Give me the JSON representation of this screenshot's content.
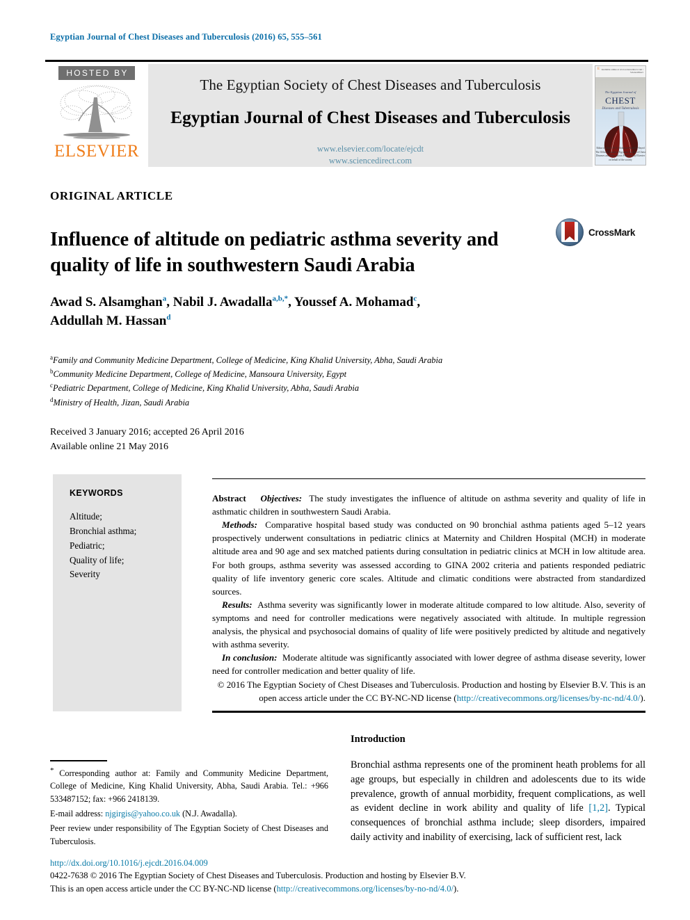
{
  "running_head": "Egyptian Journal of Chest Diseases and Tuberculosis (2016) 65, 555–561",
  "masthead": {
    "hosted_by": "HOSTED BY",
    "publisher": "ELSEVIER",
    "society_line": "The Egyptian Society of Chest Diseases and Tuberculosis",
    "journal_line": "Egyptian Journal of Chest Diseases and Tuberculosis",
    "url_1": "www.elsevier.com/locate/ejcdt",
    "url_2": "www.sciencedirect.com",
    "cover": {
      "title_main": "CHEST",
      "title_pre": "The Egyptian Journal of",
      "title_sub": "Diseases and Tuberculosis",
      "publisher_mark": "ELSEVIER",
      "top_right": "Available online at www.sciencedirect.com / ScienceDirect",
      "footer": "Editor in Chief: M.Y. Mohamed Awad El-Sayed\nThe Official Journal of Egyptian Society of Chest Diseases and Tuberculosis\nPublished by Elsevier on behalf of the society"
    }
  },
  "article": {
    "kind": "ORIGINAL ARTICLE",
    "title": "Influence of altitude on pediatric asthma severity and quality of life in southwestern Saudi Arabia",
    "crossmark_label": "CrossMark",
    "authors_line_1": "Awad S. Alsamghan",
    "authors_marks_1": "a",
    "authors_line_2": ", Nabil J. Awadalla",
    "authors_marks_2": "a,b,*",
    "authors_line_3": ", Youssef A. Mohamad",
    "authors_marks_3": "c",
    "authors_line_4": ",",
    "authors_line_5": "Addullah M. Hassan",
    "authors_marks_5": "d",
    "affiliations": [
      {
        "mark": "a",
        "text": "Family and Community Medicine Department, College of Medicine, King Khalid University, Abha, Saudi Arabia"
      },
      {
        "mark": "b",
        "text": "Community Medicine Department, College of Medicine, Mansoura University, Egypt"
      },
      {
        "mark": "c",
        "text": "Pediatric Department, College of Medicine, King Khalid University, Abha, Saudi Arabia"
      },
      {
        "mark": "d",
        "text": "Ministry of Health, Jizan, Saudi Arabia"
      }
    ],
    "received_line": "Received 3 January 2016; accepted 26 April 2016",
    "available_line": "Available online 21 May 2016"
  },
  "keywords": {
    "heading": "KEYWORDS",
    "items": [
      "Altitude;",
      "Bronchial asthma;",
      "Pediatric;",
      "Quality of life;",
      "Severity"
    ]
  },
  "abstract": {
    "label": "Abstract",
    "objectives_label": "Objectives:",
    "objectives_text": "The study investigates the influence of altitude on asthma severity and quality of life in asthmatic children in southwestern Saudi Arabia.",
    "methods_label": "Methods:",
    "methods_text": "Comparative hospital based study was conducted on 90 bronchial asthma patients aged 5–12 years prospectively underwent consultations in pediatric clinics at Maternity and Children Hospital (MCH) in moderate altitude area and 90 age and sex matched patients during consultation in pediatric clinics at MCH in low altitude area. For both groups, asthma severity was assessed according to GINA 2002 criteria and patients responded pediatric quality of life inventory generic core scales. Altitude and climatic conditions were abstracted from standardized sources.",
    "results_label": "Results:",
    "results_text": "Asthma severity was significantly lower in moderate altitude compared to low altitude. Also, severity of symptoms and need for controller medications were negatively associated with altitude. In multiple regression analysis, the physical and psychosocial domains of quality of life were positively predicted by altitude and negatively with asthma severity.",
    "conclusion_label": "In conclusion:",
    "conclusion_text": "Moderate altitude was significantly associated with lower degree of asthma disease severity, lower need for controller medication and better quality of life.",
    "copyright_text": "© 2016 The Egyptian Society of Chest Diseases and Tuberculosis. Production and hosting by Elsevier B.V. This is an open access article under the CC BY-NC-ND license (",
    "license_link": "http://creativecommons.org/licenses/by-nc-nd/4.0/",
    "copyright_tail": ")."
  },
  "footnote": {
    "corresponding_mark": "*",
    "corresponding_text": "Corresponding author at: Family and Community Medicine Department, College of Medicine, King Khalid University, Abha, Saudi Arabia. Tel.: +966 533487152; fax: +966 2418139.",
    "email_label": "E-mail address:",
    "email": "njgirgis@yahoo.co.uk",
    "email_suffix": "(N.J. Awadalla).",
    "peer_review": "Peer review under responsibility of The Egyptian Society of Chest Diseases and Tuberculosis."
  },
  "introduction": {
    "heading": "Introduction",
    "paragraph_pre": "Bronchial asthma represents one of the prominent heath problems for all age groups, but especially in children and adolescents due to its wide prevalence, growth of annual morbidity, frequent complications, as well as evident decline in work ability and quality of life ",
    "citation": "[1,2]",
    "paragraph_post": ". Typical consequences of bronchial asthma include; sleep disorders, impaired daily activity and inability of exercising, lack of sufficient rest, lack"
  },
  "page_footer": {
    "doi": "http://dx.doi.org/10.1016/j.ejcdt.2016.04.009",
    "issn_copyright": "0422-7638 © 2016 The Egyptian Society of Chest Diseases and Tuberculosis. Production and hosting by Elsevier B.V.",
    "license_pre": "This is an open access article under the CC BY-NC-ND license (",
    "license_link": "http://creativecommons.org/licenses/by-no-nd/4.0/",
    "license_tail": ")."
  },
  "colors": {
    "link_blue": "#0a7ba8",
    "runhead_blue": "#0a6ea8",
    "elsevier_orange": "#ef7d1a",
    "masthead_gray": "#e6e6e6",
    "keywords_gray": "#e4e4e4"
  }
}
